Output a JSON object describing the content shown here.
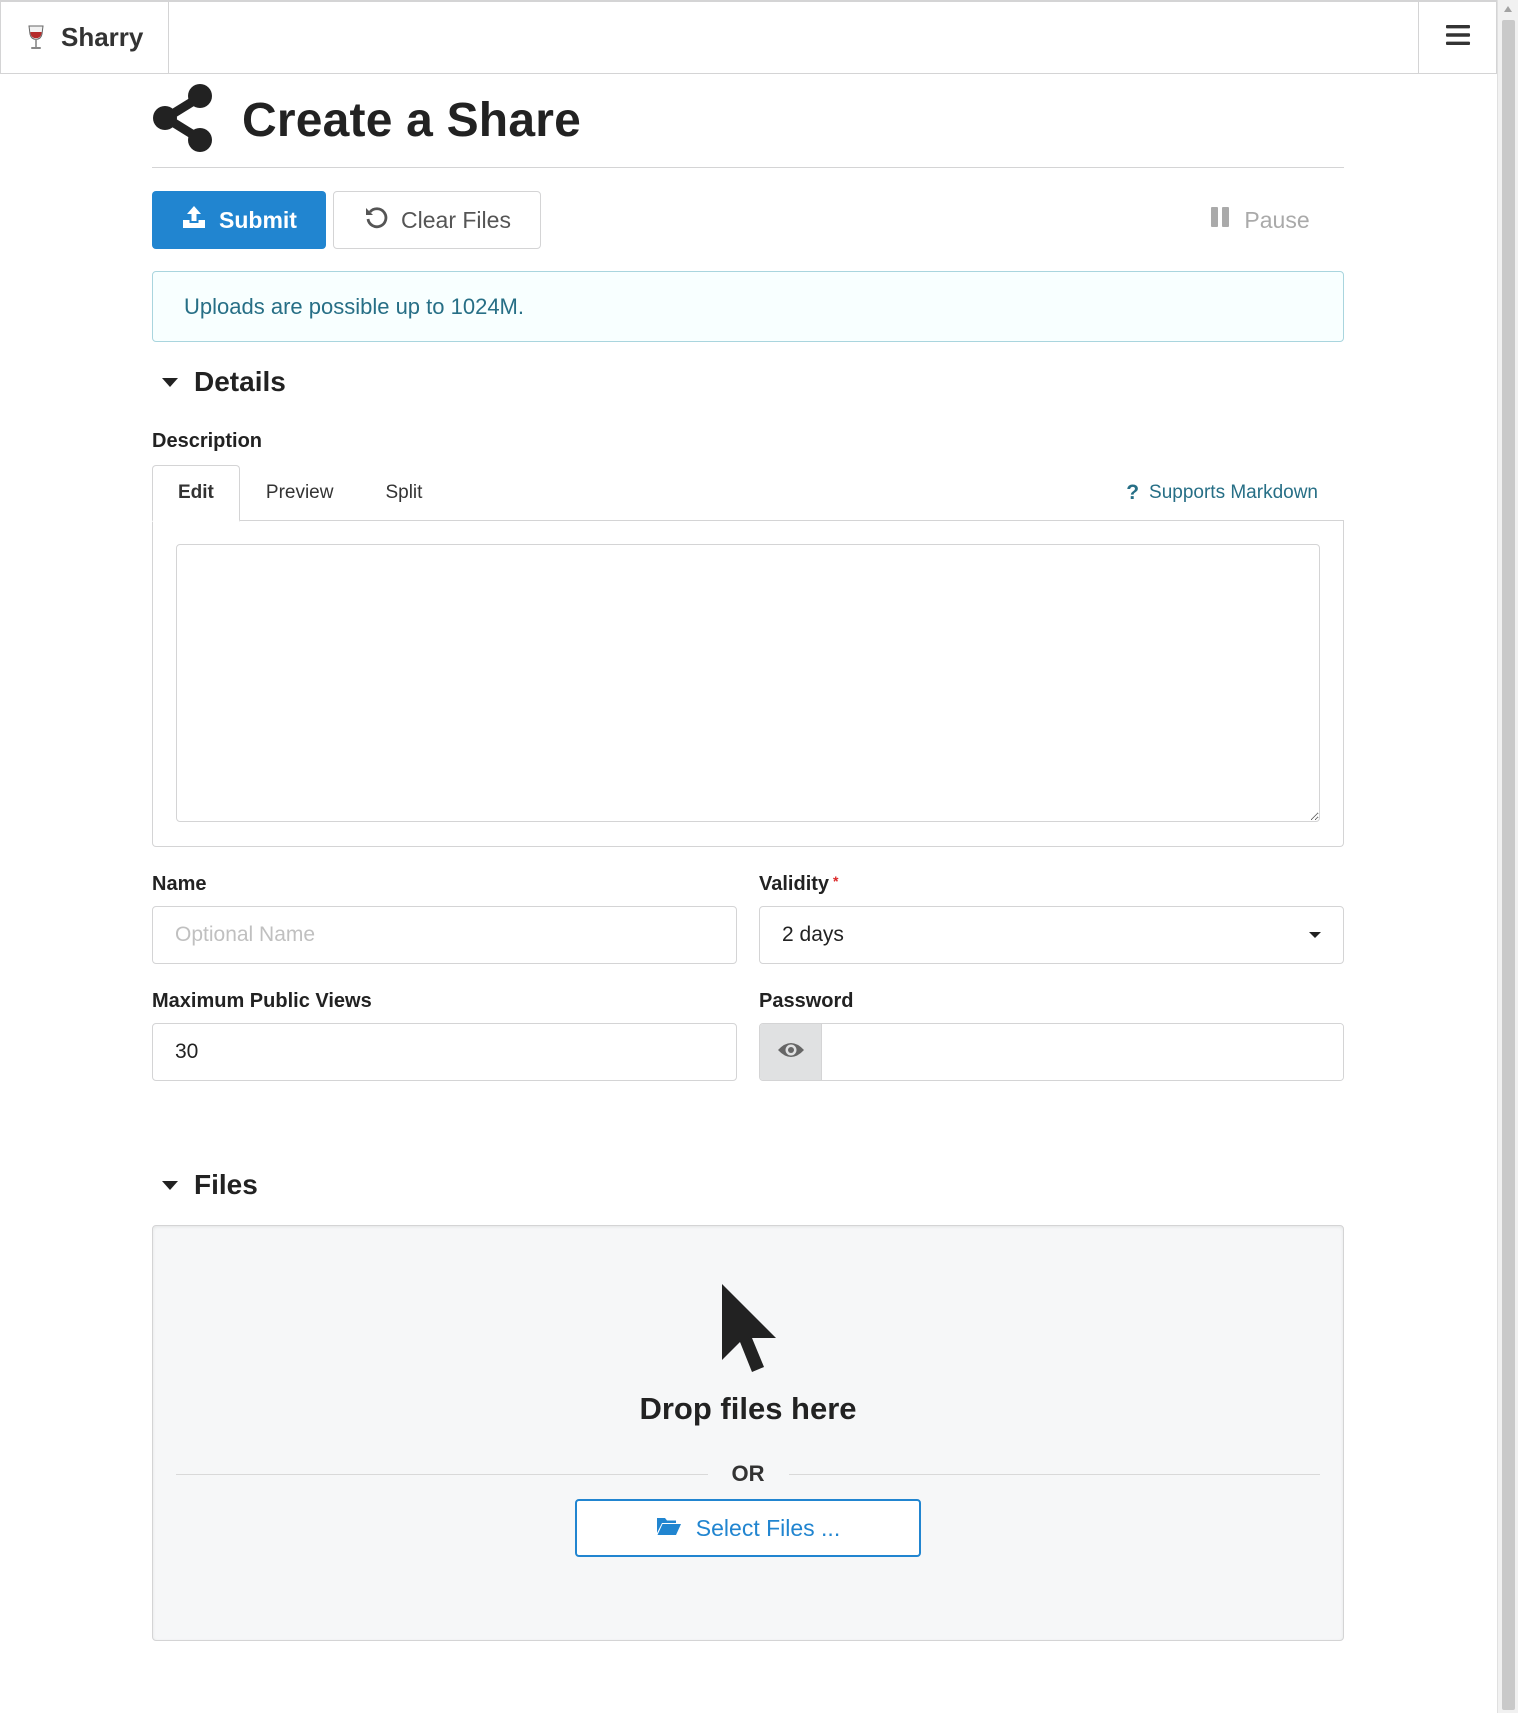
{
  "app": {
    "name": "Sharry"
  },
  "page": {
    "title": "Create a Share"
  },
  "toolbar": {
    "submit_label": "Submit",
    "clear_label": "Clear Files",
    "pause_label": "Pause"
  },
  "info": {
    "message": "Uploads are possible up to 1024M."
  },
  "details": {
    "title": "Details",
    "description_label": "Description",
    "tabs": [
      {
        "label": "Edit",
        "active": true
      },
      {
        "label": "Preview",
        "active": false
      },
      {
        "label": "Split",
        "active": false
      }
    ],
    "help_label": "Supports Markdown",
    "description_value": "",
    "name_label": "Name",
    "name_placeholder": "Optional Name",
    "validity_label": "Validity",
    "validity_required_mark": "*",
    "validity_value": "2 days",
    "max_views_label": "Maximum Public Views",
    "max_views_value": "30",
    "password_label": "Password"
  },
  "files": {
    "title": "Files",
    "drop_text": "Drop files here",
    "or_text": "OR",
    "select_label": "Select Files ..."
  },
  "colors": {
    "primary": "#2185d0",
    "info_text": "#276f86",
    "info_border": "#a9d5de",
    "required": "#db2828"
  },
  "icons": {
    "brand": "wine-glass-icon",
    "menu": "hamburger-menu-icon",
    "header": "share-alt-icon",
    "submit": "upload-icon",
    "clear": "undo-icon",
    "pause": "pause-icon",
    "help": "question-icon",
    "password_toggle": "eye-icon",
    "dropzone": "mouse-pointer-icon",
    "select_files": "folder-open-icon"
  }
}
